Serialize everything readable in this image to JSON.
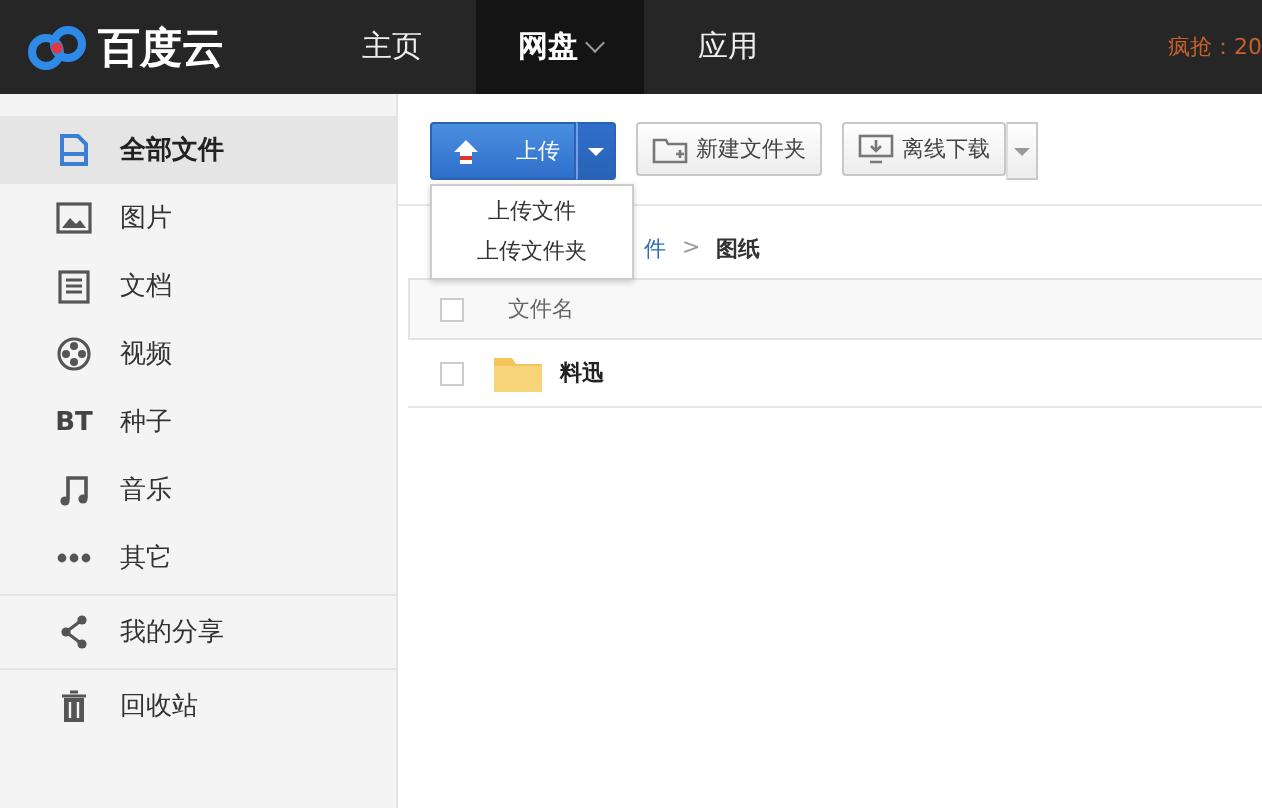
{
  "topbar": {
    "logo": "百度云",
    "nav": [
      {
        "label": "主页",
        "selected": false,
        "dropdown": false
      },
      {
        "label": "网盘",
        "selected": true,
        "dropdown": true
      },
      {
        "label": "应用",
        "selected": false,
        "dropdown": false
      }
    ],
    "promo": "疯抢：20"
  },
  "sidebar": {
    "sections": [
      [
        {
          "kind": "files",
          "label": "全部文件",
          "selected": true
        },
        {
          "kind": "image",
          "label": "图片",
          "selected": false
        },
        {
          "kind": "doc",
          "label": "文档",
          "selected": false
        },
        {
          "kind": "video",
          "label": "视频",
          "selected": false
        },
        {
          "kind": "bt",
          "icon_text": "BT",
          "label": "种子",
          "selected": false
        },
        {
          "kind": "music",
          "label": "音乐",
          "selected": false
        },
        {
          "kind": "more",
          "label": "其它",
          "selected": false
        }
      ],
      [
        {
          "kind": "share",
          "label": "我的分享",
          "selected": false
        }
      ],
      [
        {
          "kind": "trash",
          "label": "回收站",
          "selected": false
        }
      ]
    ]
  },
  "toolbar": {
    "upload": {
      "label": "上传",
      "expanded": true,
      "menu": [
        "上传文件",
        "上传文件夹"
      ]
    },
    "new_folder": "新建文件夹",
    "offline": "离线下载"
  },
  "breadcrumb": {
    "partial": "件",
    "separator": ">",
    "current": "图纸"
  },
  "table": {
    "columns": [
      "文件名"
    ],
    "header_checked": false,
    "rows": [
      {
        "name": "料迅",
        "checked": false
      }
    ]
  }
}
